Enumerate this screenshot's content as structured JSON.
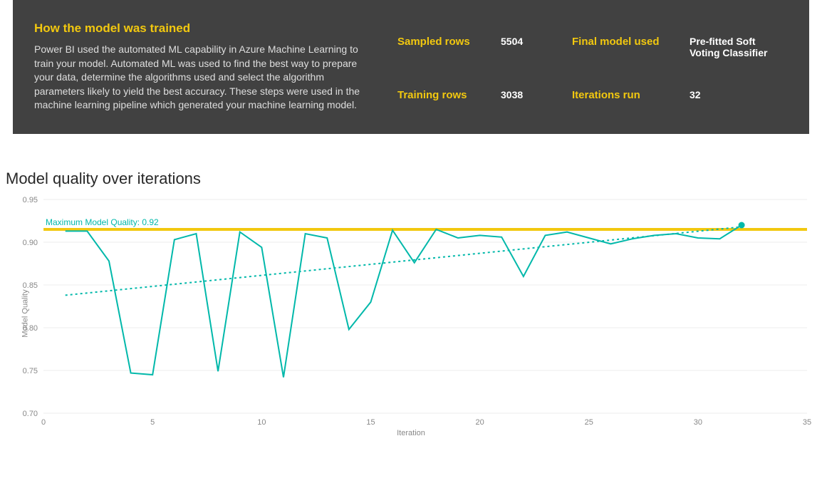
{
  "header": {
    "title": "How the model was trained",
    "description": "Power BI used the automated ML capability in Azure Machine Learning to train your model. Automated ML was used to find the best way to prepare your data, determine the algorithms used and select the algorithm parameters likely to yield the best accuracy. These steps were used in the machine learning pipeline which generated your machine learning model.",
    "stats": {
      "sampled_rows_label": "Sampled rows",
      "sampled_rows_value": "5504",
      "final_model_label": "Final model used",
      "final_model_value": "Pre-fitted Soft Voting Classifier",
      "training_rows_label": "Training rows",
      "training_rows_value": "3038",
      "iterations_label": "Iterations run",
      "iterations_value": "32"
    }
  },
  "chart": {
    "title": "Model quality over iterations",
    "max_annotation": "Maximum Model Quality: 0.92",
    "xlabel": "Iteration",
    "ylabel": "Model Quality"
  },
  "chart_data": {
    "type": "line",
    "xlabel": "Iteration",
    "ylabel": "Model Quality",
    "xlim": [
      0,
      35
    ],
    "ylim": [
      0.7,
      0.95
    ],
    "x_ticks": [
      0,
      5,
      10,
      15,
      20,
      25,
      30,
      35
    ],
    "y_ticks": [
      0.7,
      0.75,
      0.8,
      0.85,
      0.9,
      0.95
    ],
    "max_line": 0.915,
    "trend_line": {
      "x1": 1,
      "y1": 0.838,
      "x2": 32,
      "y2": 0.918
    },
    "series": [
      {
        "name": "Model Quality",
        "color": "#01B8AA",
        "x": [
          1,
          2,
          3,
          4,
          5,
          6,
          7,
          8,
          9,
          10,
          11,
          12,
          13,
          14,
          15,
          16,
          17,
          18,
          19,
          20,
          21,
          22,
          23,
          24,
          25,
          26,
          27,
          28,
          29,
          30,
          31,
          32
        ],
        "y": [
          0.913,
          0.913,
          0.878,
          0.747,
          0.745,
          0.903,
          0.91,
          0.749,
          0.912,
          0.894,
          0.742,
          0.91,
          0.905,
          0.798,
          0.83,
          0.914,
          0.876,
          0.915,
          0.905,
          0.908,
          0.906,
          0.86,
          0.908,
          0.912,
          0.905,
          0.898,
          0.904,
          0.908,
          0.91,
          0.905,
          0.904,
          0.92
        ]
      }
    ],
    "colors": {
      "series_line": "#01B8AA",
      "trend_line": "#01B8AA",
      "max_line": "#f2c80f",
      "grid": "#d9d9d9"
    }
  }
}
